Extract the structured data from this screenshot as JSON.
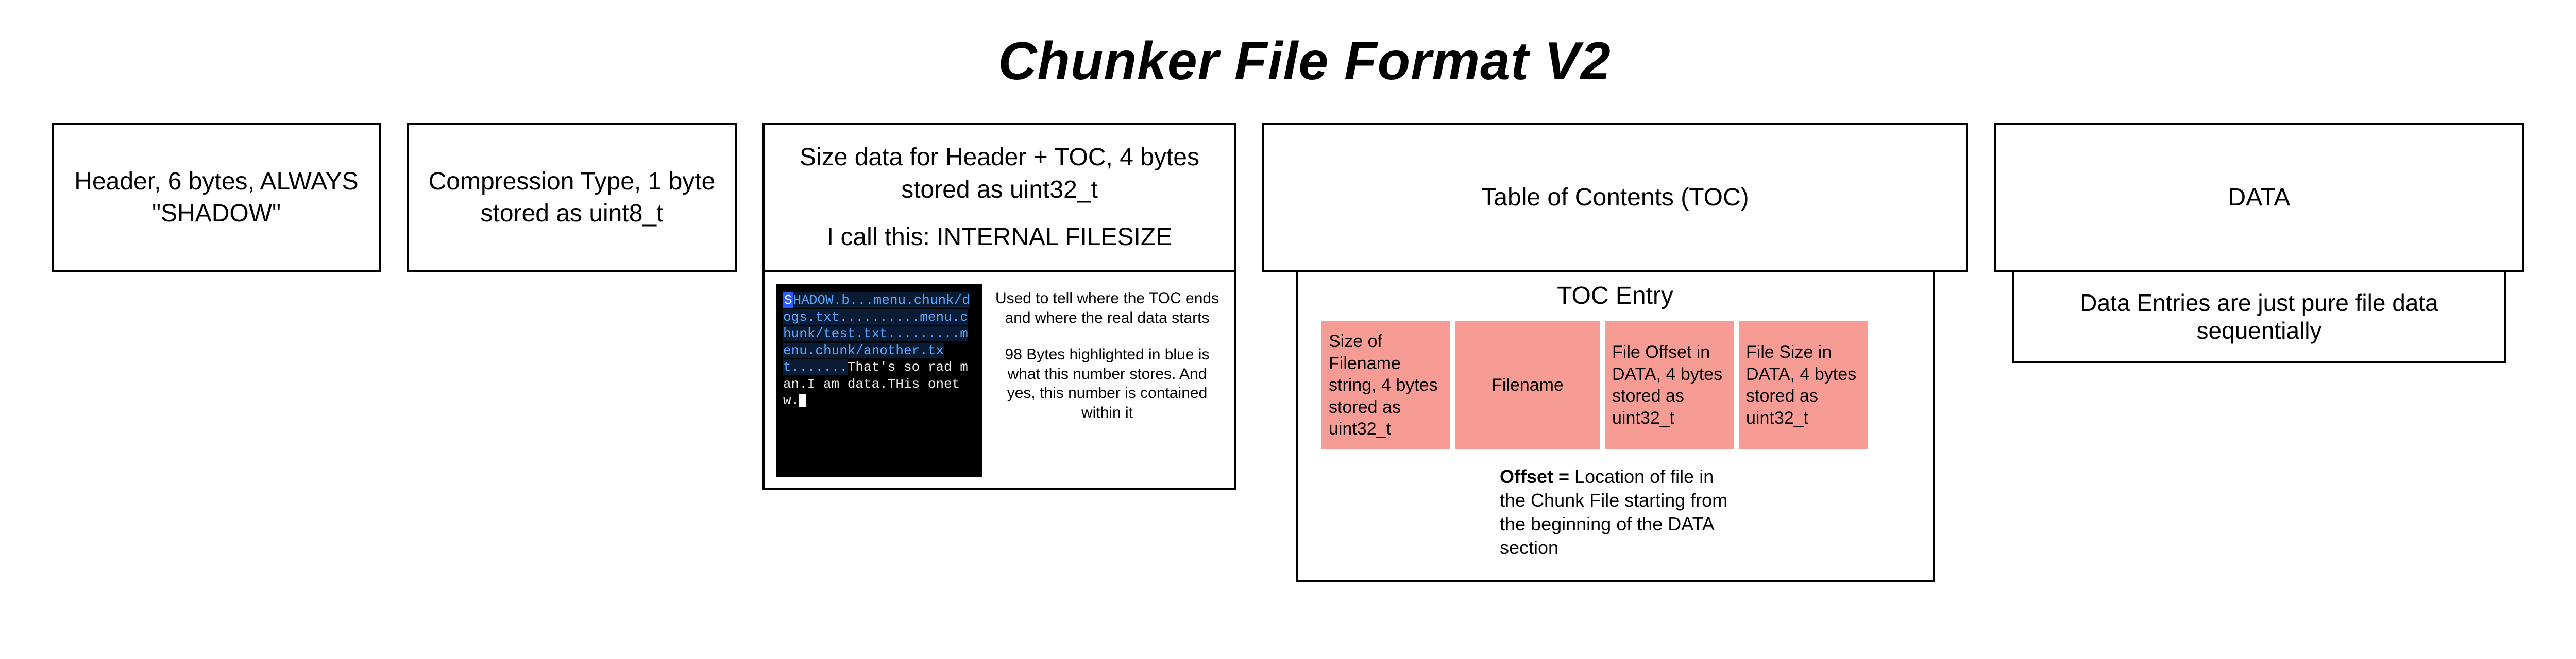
{
  "title": "Chunker File Format V2",
  "blocks": {
    "header": "Header, 6 bytes, ALWAYS \"SHADOW\"",
    "compression": "Compression Type, 1 byte stored as uint8_t",
    "size": {
      "line1": "Size data for Header + TOC, 4 bytes stored as uint32_t",
      "line2": "I call this: INTERNAL FILESIZE"
    },
    "toc": "Table of Contents (TOC)",
    "data": "DATA"
  },
  "size_detail": {
    "hex_lines": {
      "l1a": "S",
      "l1b": "HADOW.b...menu.chunk/dogs.txt..........menu.chunk/test.txt.........menu.chunk/another.txt.......",
      "l2": "That's so rad man.I am data.THis onetw.",
      "cursor": " "
    },
    "note1": "Used to tell where the TOC ends and where the real data starts",
    "note2": "98 Bytes highlighted in blue is what this number stores. And yes, this number is contained within it"
  },
  "toc_detail": {
    "title": "TOC Entry",
    "fields": [
      "Size of Filename string, 4 bytes stored as uint32_t",
      "Filename",
      "File Offset in DATA, 4 bytes stored as uint32_t",
      "File Size in DATA, 4 bytes stored as uint32_t"
    ],
    "offset_label": "Offset =",
    "offset_desc": " Location of file in the Chunk File starting from the beginning of the DATA section"
  },
  "data_detail": "Data Entries are just pure file data sequentially"
}
